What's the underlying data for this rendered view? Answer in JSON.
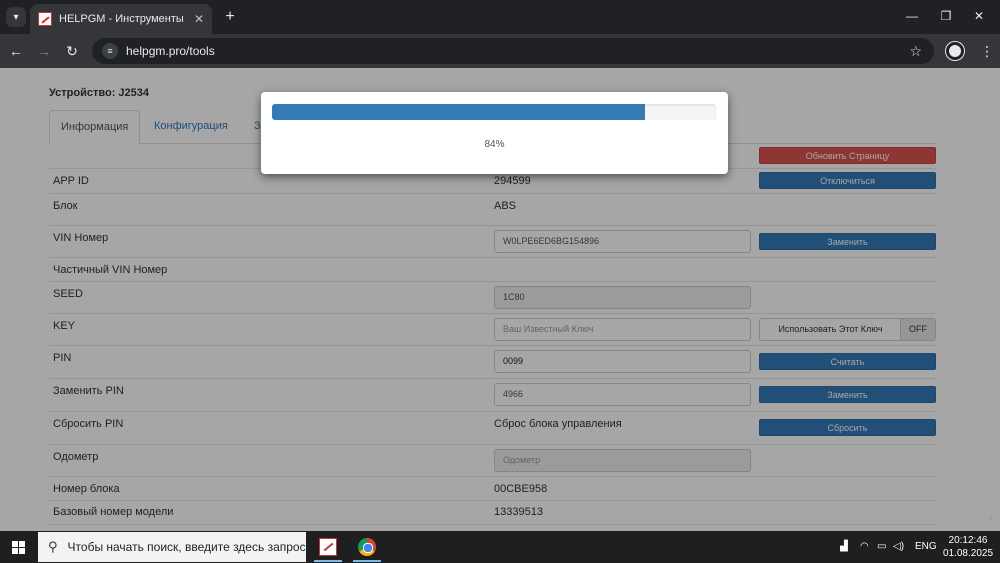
{
  "browser": {
    "tab_title": "HELPGM - Инструменты",
    "url": "helpgm.pro/tools"
  },
  "page": {
    "device_title": "Устройство: J2534",
    "tabs": [
      {
        "label": "Информация"
      },
      {
        "label": "Конфигурация"
      },
      {
        "label": "З"
      }
    ],
    "refresh_button": "Обновить Страницу",
    "rows": {
      "app_id": {
        "label": "APP ID",
        "value": "294599",
        "button": "Отключиться"
      },
      "block": {
        "label": "Блок",
        "value": "ABS"
      },
      "vin": {
        "label": "VIN Номер",
        "value": "W0LPE6ED6BG154896",
        "button": "Заменить"
      },
      "partial_vin": {
        "label": "Частичный VIN Номер"
      },
      "seed": {
        "label": "SEED",
        "value": "1C80"
      },
      "key": {
        "label": "KEY",
        "placeholder": "Ваш Известный Ключ",
        "toggle_label": "Использовать Этот Ключ",
        "toggle_state": "OFF"
      },
      "pin": {
        "label": "PIN",
        "value": "0099",
        "button": "Считать"
      },
      "change_pin": {
        "label": "Заменить PIN",
        "value": "4966",
        "button": "Заменить"
      },
      "reset_pin": {
        "label": "Сбросить PIN",
        "value": "Сброс блока управления",
        "button": "Сбросить"
      },
      "odometer": {
        "label": "Одометр",
        "placeholder": "Одометр"
      },
      "block_number": {
        "label": "Номер блока",
        "value": "00CBE958"
      },
      "base_model": {
        "label": "Базовый номер модели",
        "value": "13339513"
      }
    }
  },
  "modal": {
    "progress": 84,
    "percent_text": "84%"
  },
  "taskbar": {
    "search_placeholder": "Чтобы начать поиск, введите здесь запрос",
    "language": "ENG",
    "time": "20:12:46",
    "date": "01.08.2025"
  },
  "colors": {
    "primary": "#337ab7",
    "danger": "#d9534f"
  }
}
